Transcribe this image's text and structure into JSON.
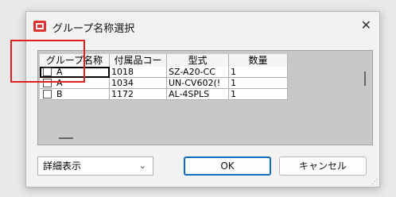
{
  "window": {
    "title": "グループ名称選択",
    "close_glyph": "✕"
  },
  "table": {
    "columns": [
      "グループ名称",
      "付属品コー",
      "型式",
      "数量"
    ],
    "rows": [
      {
        "group": "A",
        "code": "1018",
        "model": "SZ-A20-CC",
        "qty": "1"
      },
      {
        "group": "A",
        "code": "1034",
        "model": "UN-CV602(!",
        "qty": "1"
      },
      {
        "group": "B",
        "code": "1172",
        "model": "AL-4SPLS",
        "qty": "1"
      }
    ]
  },
  "footer": {
    "view_select": "詳細表示",
    "ok_label": "OK",
    "cancel_label": "キャンセル"
  },
  "colors": {
    "highlight": "#e02020",
    "ok_border": "#0f6cbd",
    "app_icon": "#e03030"
  }
}
